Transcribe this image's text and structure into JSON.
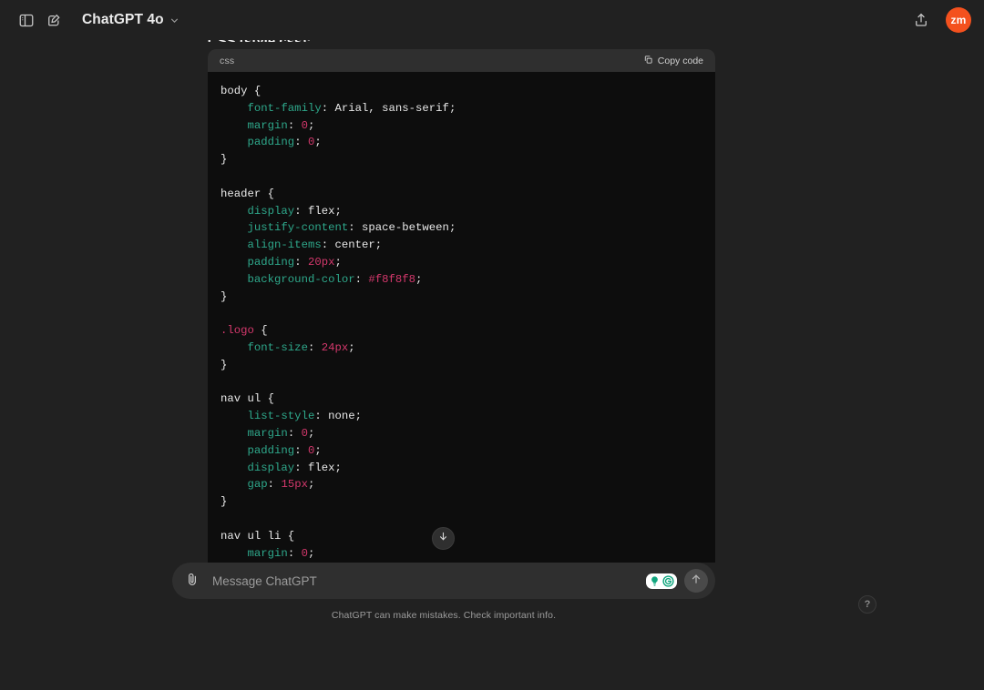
{
  "topbar": {
    "sidebar_toggle_name": "sidebar-toggle-icon",
    "new_chat_name": "new-chat-icon",
    "model_label": "ChatGPT 4o",
    "chevron_name": "chevron-down-icon",
    "share_name": "share-icon",
    "avatar_initials": "zm"
  },
  "message": {
    "cut_off_heading": "CSS (style.css):"
  },
  "code_block": {
    "language": "css",
    "copy_label": "Copy code",
    "copy_icon": "copy-icon",
    "lines": [
      [
        {
          "t": "body ",
          "c": "tok-sel"
        },
        {
          "t": "{",
          "c": "tok-punc"
        }
      ],
      [
        {
          "t": "    ",
          "c": "tok-punc"
        },
        {
          "t": "font-family",
          "c": "tok-prop"
        },
        {
          "t": ": ",
          "c": "tok-punc"
        },
        {
          "t": "Arial, sans-serif",
          "c": "tok-val"
        },
        {
          "t": ";",
          "c": "tok-punc"
        }
      ],
      [
        {
          "t": "    ",
          "c": "tok-punc"
        },
        {
          "t": "margin",
          "c": "tok-prop"
        },
        {
          "t": ": ",
          "c": "tok-punc"
        },
        {
          "t": "0",
          "c": "tok-num"
        },
        {
          "t": ";",
          "c": "tok-punc"
        }
      ],
      [
        {
          "t": "    ",
          "c": "tok-punc"
        },
        {
          "t": "padding",
          "c": "tok-prop"
        },
        {
          "t": ": ",
          "c": "tok-punc"
        },
        {
          "t": "0",
          "c": "tok-num"
        },
        {
          "t": ";",
          "c": "tok-punc"
        }
      ],
      [
        {
          "t": "}",
          "c": "tok-punc"
        }
      ],
      [
        {
          "t": "",
          "c": "tok-punc"
        }
      ],
      [
        {
          "t": "header ",
          "c": "tok-sel"
        },
        {
          "t": "{",
          "c": "tok-punc"
        }
      ],
      [
        {
          "t": "    ",
          "c": "tok-punc"
        },
        {
          "t": "display",
          "c": "tok-prop"
        },
        {
          "t": ": ",
          "c": "tok-punc"
        },
        {
          "t": "flex",
          "c": "tok-val"
        },
        {
          "t": ";",
          "c": "tok-punc"
        }
      ],
      [
        {
          "t": "    ",
          "c": "tok-punc"
        },
        {
          "t": "justify-content",
          "c": "tok-prop"
        },
        {
          "t": ": ",
          "c": "tok-punc"
        },
        {
          "t": "space-between",
          "c": "tok-val"
        },
        {
          "t": ";",
          "c": "tok-punc"
        }
      ],
      [
        {
          "t": "    ",
          "c": "tok-punc"
        },
        {
          "t": "align-items",
          "c": "tok-prop"
        },
        {
          "t": ": ",
          "c": "tok-punc"
        },
        {
          "t": "center",
          "c": "tok-val"
        },
        {
          "t": ";",
          "c": "tok-punc"
        }
      ],
      [
        {
          "t": "    ",
          "c": "tok-punc"
        },
        {
          "t": "padding",
          "c": "tok-prop"
        },
        {
          "t": ": ",
          "c": "tok-punc"
        },
        {
          "t": "20px",
          "c": "tok-num"
        },
        {
          "t": ";",
          "c": "tok-punc"
        }
      ],
      [
        {
          "t": "    ",
          "c": "tok-punc"
        },
        {
          "t": "background-color",
          "c": "tok-prop"
        },
        {
          "t": ": ",
          "c": "tok-punc"
        },
        {
          "t": "#f8f8f8",
          "c": "tok-num"
        },
        {
          "t": ";",
          "c": "tok-punc"
        }
      ],
      [
        {
          "t": "}",
          "c": "tok-punc"
        }
      ],
      [
        {
          "t": "",
          "c": "tok-punc"
        }
      ],
      [
        {
          "t": ".logo ",
          "c": "tok-cls"
        },
        {
          "t": "{",
          "c": "tok-punc"
        }
      ],
      [
        {
          "t": "    ",
          "c": "tok-punc"
        },
        {
          "t": "font-size",
          "c": "tok-prop"
        },
        {
          "t": ": ",
          "c": "tok-punc"
        },
        {
          "t": "24px",
          "c": "tok-num"
        },
        {
          "t": ";",
          "c": "tok-punc"
        }
      ],
      [
        {
          "t": "}",
          "c": "tok-punc"
        }
      ],
      [
        {
          "t": "",
          "c": "tok-punc"
        }
      ],
      [
        {
          "t": "nav ul ",
          "c": "tok-sel"
        },
        {
          "t": "{",
          "c": "tok-punc"
        }
      ],
      [
        {
          "t": "    ",
          "c": "tok-punc"
        },
        {
          "t": "list-style",
          "c": "tok-prop"
        },
        {
          "t": ": ",
          "c": "tok-punc"
        },
        {
          "t": "none",
          "c": "tok-val"
        },
        {
          "t": ";",
          "c": "tok-punc"
        }
      ],
      [
        {
          "t": "    ",
          "c": "tok-punc"
        },
        {
          "t": "margin",
          "c": "tok-prop"
        },
        {
          "t": ": ",
          "c": "tok-punc"
        },
        {
          "t": "0",
          "c": "tok-num"
        },
        {
          "t": ";",
          "c": "tok-punc"
        }
      ],
      [
        {
          "t": "    ",
          "c": "tok-punc"
        },
        {
          "t": "padding",
          "c": "tok-prop"
        },
        {
          "t": ": ",
          "c": "tok-punc"
        },
        {
          "t": "0",
          "c": "tok-num"
        },
        {
          "t": ";",
          "c": "tok-punc"
        }
      ],
      [
        {
          "t": "    ",
          "c": "tok-punc"
        },
        {
          "t": "display",
          "c": "tok-prop"
        },
        {
          "t": ": ",
          "c": "tok-punc"
        },
        {
          "t": "flex",
          "c": "tok-val"
        },
        {
          "t": ";",
          "c": "tok-punc"
        }
      ],
      [
        {
          "t": "    ",
          "c": "tok-punc"
        },
        {
          "t": "gap",
          "c": "tok-prop"
        },
        {
          "t": ": ",
          "c": "tok-punc"
        },
        {
          "t": "15px",
          "c": "tok-num"
        },
        {
          "t": ";",
          "c": "tok-punc"
        }
      ],
      [
        {
          "t": "}",
          "c": "tok-punc"
        }
      ],
      [
        {
          "t": "",
          "c": "tok-punc"
        }
      ],
      [
        {
          "t": "nav ul li ",
          "c": "tok-sel"
        },
        {
          "t": "{",
          "c": "tok-punc"
        }
      ],
      [
        {
          "t": "    ",
          "c": "tok-punc"
        },
        {
          "t": "margin",
          "c": "tok-prop"
        },
        {
          "t": ": ",
          "c": "tok-punc"
        },
        {
          "t": "0",
          "c": "tok-num"
        },
        {
          "t": ";",
          "c": "tok-punc"
        }
      ]
    ]
  },
  "scroll_down": {
    "icon": "arrow-down-icon"
  },
  "composer": {
    "attach_icon": "paperclip-icon",
    "placeholder": "Message ChatGPT",
    "value": "",
    "grammarly_icons": [
      "lightbulb-icon",
      "grammarly-icon"
    ],
    "send_icon": "arrow-up-icon",
    "disclaimer": "ChatGPT can make mistakes. Check important info."
  },
  "help": {
    "label": "?"
  },
  "colors": {
    "page_bg": "#212121",
    "code_bg": "#0d0d0d",
    "code_head_bg": "#2f2f2f",
    "accent_avatar": "#f4511e",
    "prop": "#2ea88b",
    "num": "#d4386c",
    "grammarly_green": "#15c39a"
  }
}
